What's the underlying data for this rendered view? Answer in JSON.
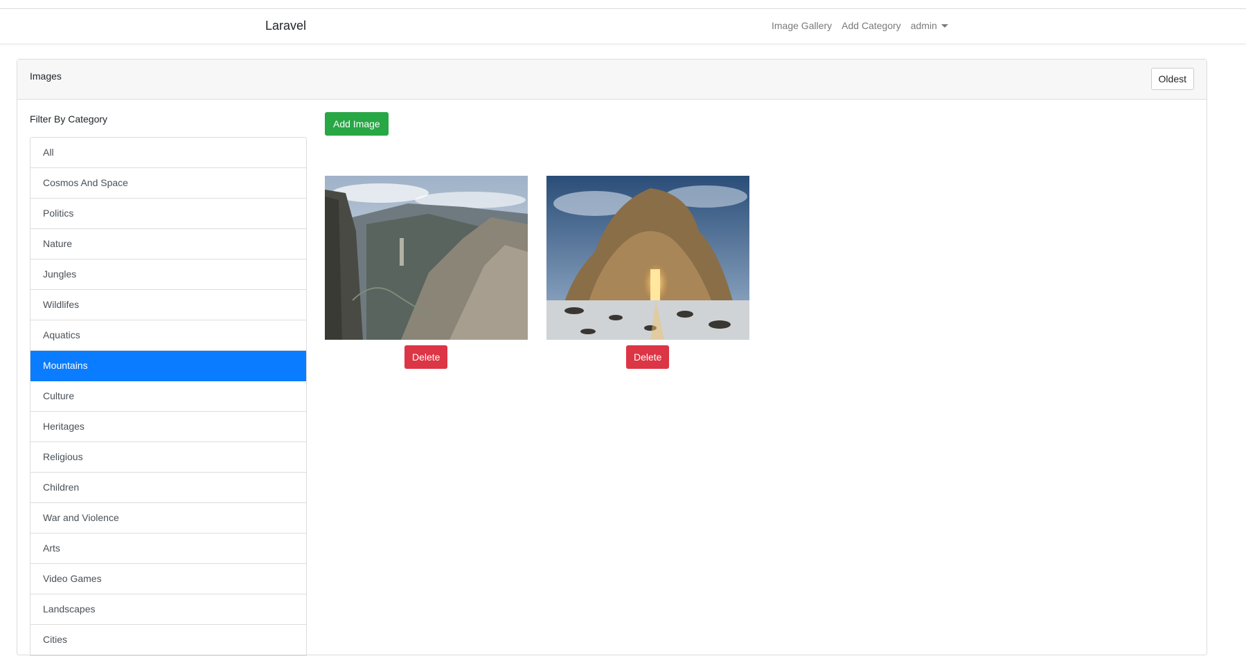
{
  "navbar": {
    "brand": "Laravel",
    "links": [
      "Image Gallery",
      "Add Category"
    ],
    "user": "admin"
  },
  "card": {
    "title": "Images",
    "sort_button": "Oldest"
  },
  "filter": {
    "label": "Filter By Category",
    "items": [
      "All",
      "Cosmos And Space",
      "Politics",
      "Nature",
      "Jungles",
      "Wildlifes",
      "Aquatics",
      "Mountains",
      "Culture",
      "Heritages",
      "Religious",
      "Children",
      "War and Violence",
      "Arts",
      "Video Games",
      "Landscapes",
      "Cities"
    ],
    "active": "Mountains"
  },
  "gallery": {
    "add_button": "Add Image",
    "images": [
      {
        "alt": "mountain-valley",
        "delete_label": "Delete"
      },
      {
        "alt": "sea-arch",
        "delete_label": "Delete"
      }
    ]
  },
  "colors": {
    "active": "#0a7cff",
    "success": "#28a745",
    "danger": "#dc3545"
  }
}
